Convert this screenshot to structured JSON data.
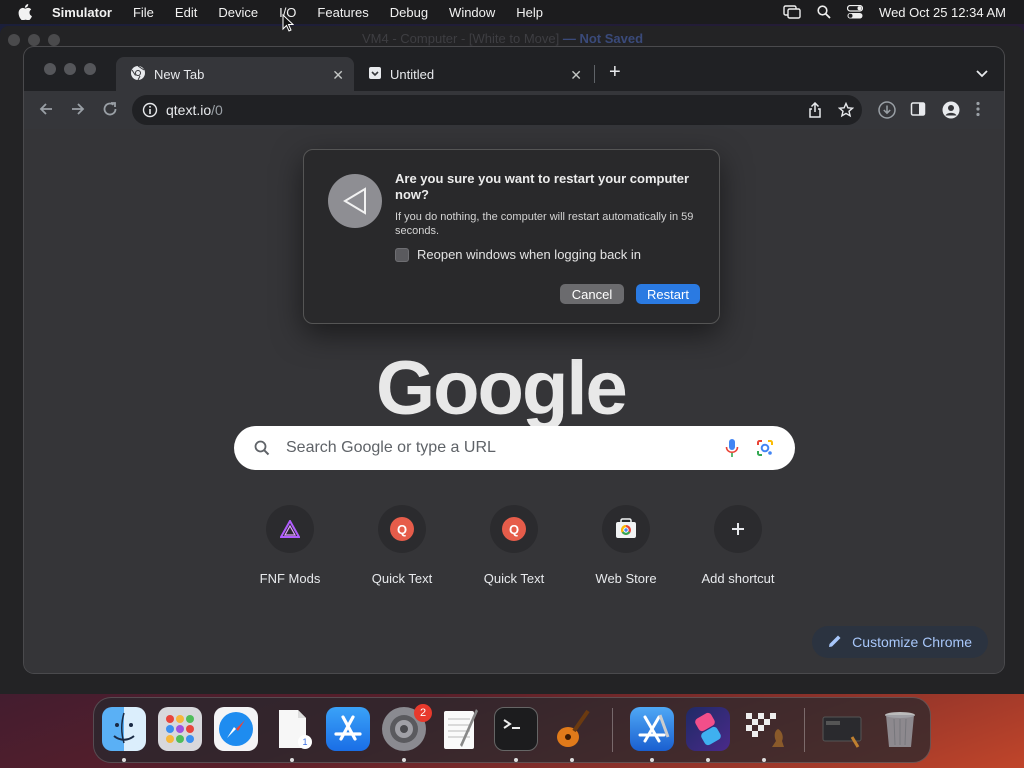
{
  "menubar": {
    "app_name": "Simulator",
    "items": [
      "File",
      "Edit",
      "Device",
      "I/O",
      "Features",
      "Debug",
      "Window",
      "Help"
    ],
    "clock": "Wed Oct 25  12:34 AM"
  },
  "simulator_window": {
    "title": "VM4 - Computer - [White to Move]",
    "status": "— Not Saved"
  },
  "chrome": {
    "tabs": [
      {
        "title": "New Tab",
        "icon": "chrome-icon",
        "active": true
      },
      {
        "title": "Untitled",
        "icon": "page-icon",
        "active": false
      }
    ],
    "url_host": "qtext.io",
    "url_path": "/0"
  },
  "newtab": {
    "logo_text": "Google",
    "search_placeholder": "Search Google or type a URL",
    "shortcuts": [
      {
        "label": "FNF Mods",
        "icon": "fnf-triangle-icon"
      },
      {
        "label": "Quick Text",
        "icon": "quick-text-icon",
        "badge": "Q"
      },
      {
        "label": "Quick Text",
        "icon": "quick-text-icon",
        "badge": "Q"
      },
      {
        "label": "Web Store",
        "icon": "web-store-icon"
      },
      {
        "label": "Add shortcut",
        "icon": "plus-icon"
      }
    ],
    "customize_label": "Customize Chrome"
  },
  "dialog": {
    "title": "Are you sure you want to restart your computer now?",
    "body": "If you do nothing, the computer will restart automatically in 59 seconds.",
    "checkbox_label": "Reopen windows when logging back in",
    "checkbox_checked": false,
    "cancel_label": "Cancel",
    "restart_label": "Restart"
  },
  "dock": {
    "apps": [
      {
        "name": "finder-icon",
        "running": true
      },
      {
        "name": "launchpad-icon",
        "running": false
      },
      {
        "name": "safari-icon",
        "running": false
      },
      {
        "name": "document-icon",
        "running": true,
        "badge": "1"
      },
      {
        "name": "app-store-icon",
        "running": false
      },
      {
        "name": "system-settings-icon",
        "running": true,
        "badge": "2"
      },
      {
        "name": "textedit-icon",
        "running": false
      },
      {
        "name": "terminal-icon",
        "running": true
      },
      {
        "name": "garageband-icon",
        "running": true
      },
      {
        "name": "xcode-icon",
        "running": true
      },
      {
        "name": "shortcuts-icon",
        "running": true
      },
      {
        "name": "chess-icon",
        "running": true
      },
      {
        "name": "screen-preview-icon",
        "running": false
      },
      {
        "name": "trash-icon",
        "running": false
      }
    ]
  },
  "colors": {
    "accent_blue": "#2a7ae2",
    "chrome_bg": "#353538",
    "dialog_bg": "#29292b"
  }
}
